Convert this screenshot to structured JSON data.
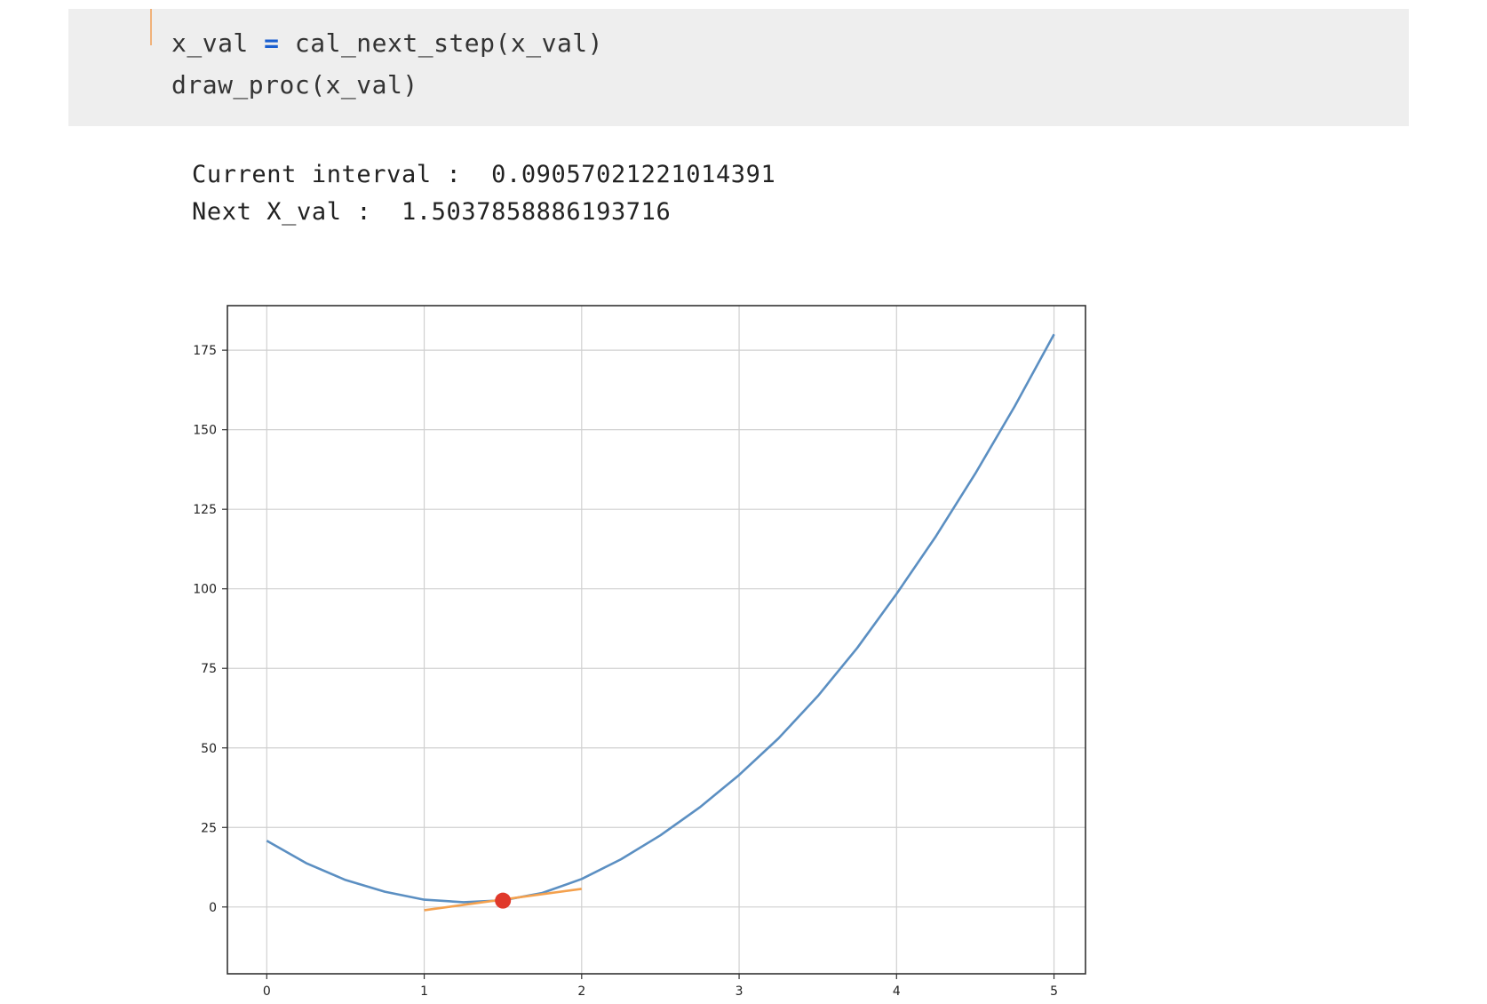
{
  "code_cell": {
    "line1": {
      "lhs": "x_val",
      "op": "=",
      "rhs": "cal_next_step(x_val)"
    },
    "line2": "draw_proc(x_val)"
  },
  "output": {
    "line1": "Current interval :  0.09057021221014391",
    "line2": "Next X_val :  1.5037858886193716"
  },
  "chart_data": {
    "type": "line",
    "title": "",
    "xlabel": "",
    "ylabel": "",
    "xlim": [
      -0.25,
      5.2
    ],
    "ylim": [
      -21,
      189
    ],
    "xticks": [
      0,
      1,
      2,
      3,
      4,
      5
    ],
    "yticks": [
      0,
      25,
      50,
      75,
      100,
      125,
      150,
      175
    ],
    "grid": true,
    "series": [
      {
        "kind": "curve",
        "color": "#5b8fc2",
        "x": [
          0,
          0.25,
          0.5,
          0.75,
          1.0,
          1.25,
          1.5,
          1.75,
          2.0,
          2.25,
          2.5,
          2.75,
          3.0,
          3.25,
          3.5,
          3.75,
          4.0,
          4.25,
          4.5,
          4.75,
          5.0
        ],
        "y": [
          20.8,
          13.8,
          8.5,
          4.8,
          2.3,
          1.5,
          2.1,
          4.4,
          8.8,
          15.0,
          22.5,
          31.3,
          41.5,
          53.0,
          66.3,
          81.4,
          98.4,
          116.5,
          136.2,
          157.3,
          180.0
        ]
      },
      {
        "kind": "tangent",
        "color": "#f4a14e",
        "x": [
          1.0,
          2.0
        ],
        "y": [
          -1.0,
          5.7
        ]
      },
      {
        "kind": "point",
        "color": "#e0392b",
        "x": [
          1.5
        ],
        "y": [
          2.0
        ]
      }
    ]
  }
}
